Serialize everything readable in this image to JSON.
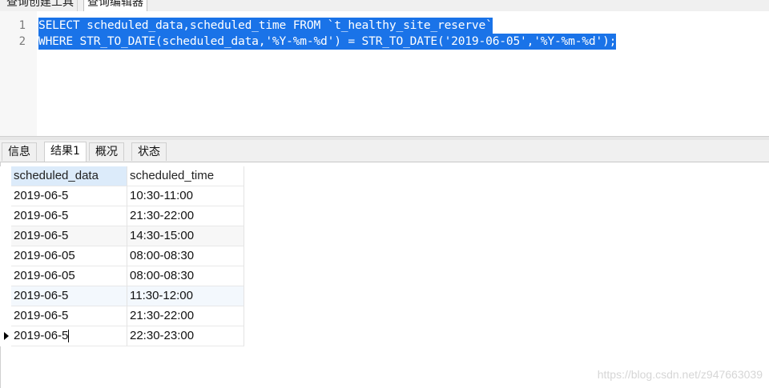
{
  "top_tabs": [
    "查询创建工具",
    "查询编辑器"
  ],
  "editor": {
    "line_numbers": [
      "1",
      "2"
    ],
    "lines": [
      "SELECT scheduled_data,scheduled_time FROM `t_healthy_site_reserve`",
      "WHERE STR_TO_DATE(scheduled_data,'%Y-%m-%d') = STR_TO_DATE('2019-06-05','%Y-%m-%d');"
    ],
    "selection_color": "#1a73e8"
  },
  "result_tabs": [
    "信息",
    "结果1",
    "概况",
    "状态"
  ],
  "result_tabs_active": "结果1",
  "grid": {
    "columns": [
      "scheduled_data",
      "scheduled_time"
    ],
    "rows": [
      [
        "2019-06-5",
        "10:30-11:00"
      ],
      [
        "2019-06-5",
        "21:30-22:00"
      ],
      [
        "2019-06-5",
        "14:30-15:00"
      ],
      [
        "2019-06-05",
        "08:00-08:30"
      ],
      [
        "2019-06-05",
        "08:00-08:30"
      ],
      [
        "2019-06-5",
        "11:30-12:00"
      ],
      [
        "2019-06-5",
        "21:30-22:00"
      ],
      [
        "2019-06-5",
        "22:30-23:00"
      ]
    ]
  },
  "watermark": "https://blog.csdn.net/z947663039"
}
